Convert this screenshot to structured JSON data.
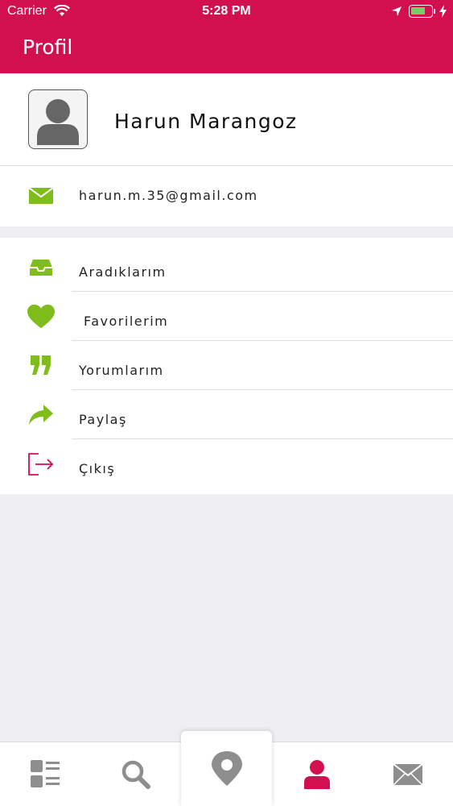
{
  "status_bar": {
    "carrier": "Carrier",
    "time": "5:28 PM"
  },
  "header": {
    "title": "Profil"
  },
  "profile": {
    "name": "Harun Marangoz",
    "email": "harun.m.35@gmail.com"
  },
  "menu": {
    "items": [
      {
        "label": "Aradıklarım",
        "icon": "inbox-icon",
        "color": "#7fbd1c"
      },
      {
        "label": "Favorilerim",
        "icon": "heart-icon",
        "color": "#7fbd1c"
      },
      {
        "label": "Yorumlarım",
        "icon": "quote-icon",
        "color": "#7fbd1c"
      },
      {
        "label": "Paylaş",
        "icon": "share-icon",
        "color": "#7fbd1c"
      },
      {
        "label": "Çıkış",
        "icon": "logout-icon",
        "color": "#d2104f"
      }
    ]
  },
  "tab_bar": {
    "items": [
      {
        "icon": "list-icon",
        "active": false
      },
      {
        "icon": "search-icon",
        "active": false
      },
      {
        "icon": "map-pin-icon",
        "active": false
      },
      {
        "icon": "user-icon",
        "active": true
      },
      {
        "icon": "mail-icon",
        "active": false
      }
    ]
  },
  "colors": {
    "brand": "#d2104f",
    "accent_green": "#7fbd1c",
    "tab_icon_gray": "#8e8e8e"
  }
}
